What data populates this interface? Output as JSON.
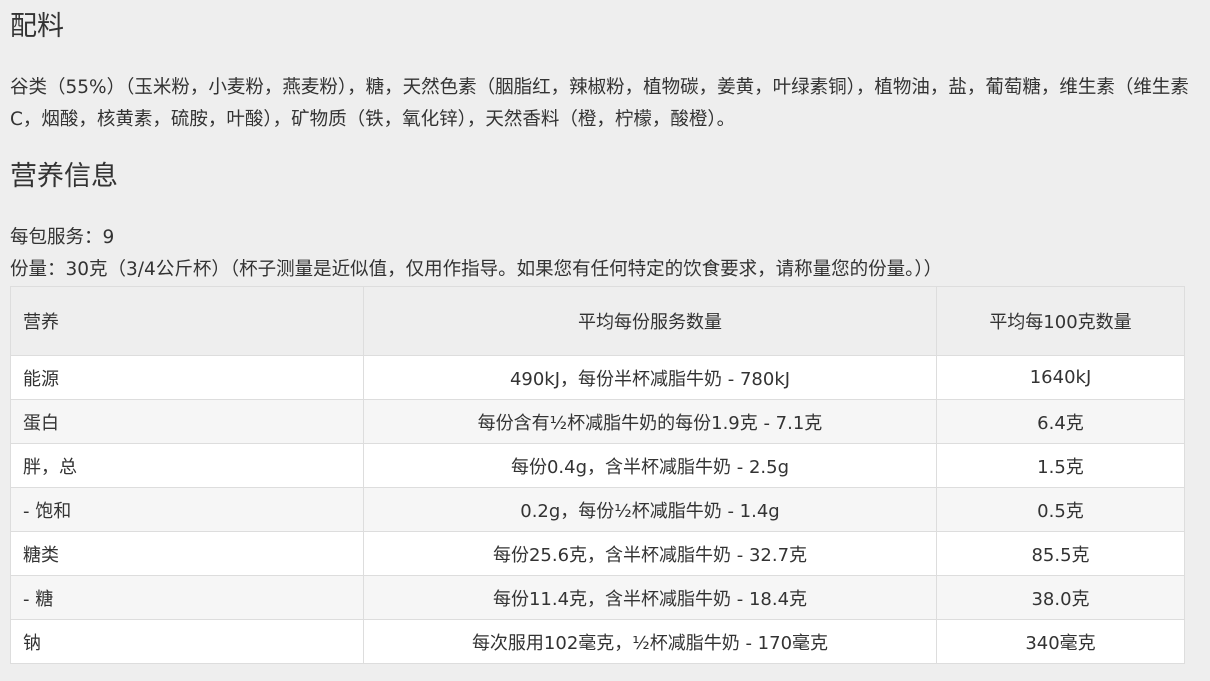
{
  "ingredients": {
    "heading": "配料",
    "text": "谷类（55%）（玉米粉，小麦粉，燕麦粉），糖，天然色素（胭脂红，辣椒粉，植物碳，姜黄，叶绿素铜），植物油，盐，葡萄糖，维生素（维生素C，烟酸，核黄素，硫胺，叶酸），矿物质（铁，氧化锌），天然香料（橙，柠檬，酸橙）。"
  },
  "nutrition": {
    "heading": "营养信息",
    "servings_per_pack": "每包服务：9",
    "serving_size": "份量：30克（3/4公斤杯）（杯子测量是近似值，仅用作指导。如果您有任何特定的饮食要求，请称量您的份量。））",
    "table": {
      "headers": [
        "营养",
        "平均每份服务数量",
        "平均每100克数量"
      ],
      "rows": [
        [
          "能源",
          "490kJ，每份半杯减脂牛奶 - 780kJ",
          "1640kJ"
        ],
        [
          "蛋白",
          "每份含有½杯减脂牛奶的每份1.9克 - 7.1克",
          "6.4克"
        ],
        [
          "胖，总",
          "每份0.4g，含半杯减脂牛奶 - 2.5g",
          "1.5克"
        ],
        [
          "- 饱和",
          "0.2g，每份½杯减脂牛奶 - 1.4g",
          "0.5克"
        ],
        [
          "糖类",
          "每份25.6克，含半杯减脂牛奶 - 32.7克",
          "85.5克"
        ],
        [
          "- 糖",
          "每份11.4克，含半杯减脂牛奶 - 18.4克",
          "38.0克"
        ],
        [
          "钠",
          "每次服用102毫克，½杯减脂牛奶 - 170毫克",
          "340毫克"
        ]
      ]
    }
  }
}
